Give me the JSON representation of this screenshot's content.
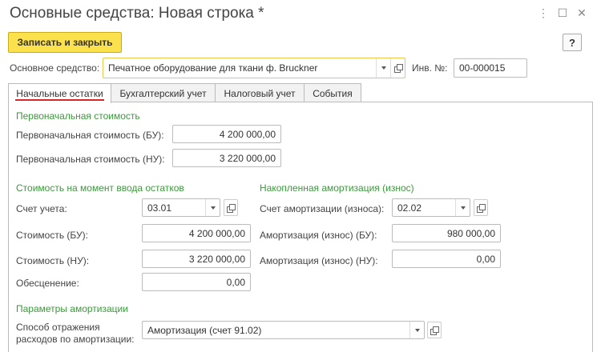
{
  "window": {
    "title": "Основные средства: Новая строка *"
  },
  "toolbar": {
    "save_close_label": "Записать и закрыть",
    "help_label": "?"
  },
  "header": {
    "asset_label": "Основное средство:",
    "asset_value": "Печатное оборудование для ткани ф. Bruckner",
    "inv_label": "Инв. №:",
    "inv_value": "00-000015"
  },
  "tabs": [
    {
      "label": "Начальные остатки",
      "active": true
    },
    {
      "label": "Бухгалтерский учет",
      "active": false
    },
    {
      "label": "Налоговый учет",
      "active": false
    },
    {
      "label": "События",
      "active": false
    }
  ],
  "initial_cost": {
    "section_title": "Первоначальная стоимость",
    "bu_label": "Первоначальная стоимость (БУ):",
    "bu_value": "4 200 000,00",
    "nu_label": "Первоначальная стоимость (НУ):",
    "nu_value": "3 220 000,00"
  },
  "balance_cost": {
    "section_title": "Стоимость на момент ввода остатков",
    "account_label": "Счет учета:",
    "account_value": "03.01",
    "cost_bu_label": "Стоимость (БУ):",
    "cost_bu_value": "4 200 000,00",
    "cost_nu_label": "Стоимость (НУ):",
    "cost_nu_value": "3 220 000,00",
    "impairment_label": "Обесценение:",
    "impairment_value": "0,00"
  },
  "depreciation": {
    "section_title": "Накопленная амортизация (износ)",
    "account_label": "Счет амортизации (износа):",
    "account_value": "02.02",
    "bu_label": "Амортизация (износ) (БУ):",
    "bu_value": "980 000,00",
    "nu_label": "Амортизация (износ) (НУ):",
    "nu_value": "0,00"
  },
  "params": {
    "section_title": "Параметры амортизации",
    "method_label_line1": "Способ отражения",
    "method_label_line2": "расходов по амортизации:",
    "method_value": "Амортизация (счет 91.02)"
  },
  "colors": {
    "accent_yellow": "#fbe14b",
    "section_green": "#3a9a3a",
    "active_tab_underline": "#d9262a"
  }
}
